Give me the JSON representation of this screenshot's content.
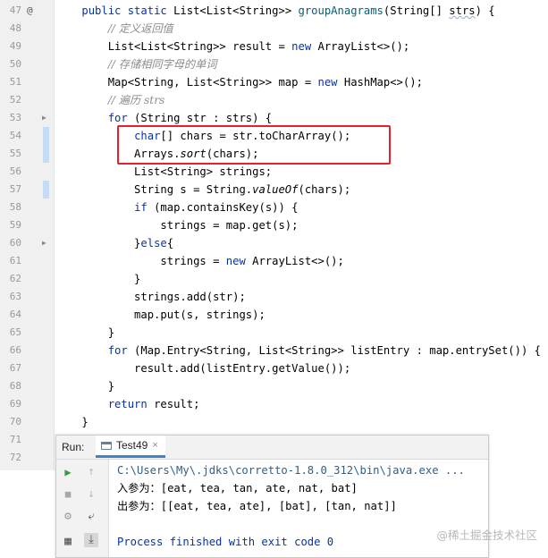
{
  "editor": {
    "lines": [
      {
        "num": "47",
        "html": "    <span class=\"kw\">public static</span> List&lt;List&lt;String&gt;&gt; <span class=\"fn\">groupAnagrams</span>(String[] <span class=\"wavy\">strs</span>) {"
      },
      {
        "num": "48",
        "html": "        <span class=\"cm\">// 定义返回值</span>"
      },
      {
        "num": "49",
        "html": "        List&lt;List&lt;String&gt;&gt; result = <span class=\"kw\">new</span> ArrayList&lt;&gt;();"
      },
      {
        "num": "50",
        "html": "        <span class=\"cm\">// 存储相同字母的单词</span>"
      },
      {
        "num": "51",
        "html": "        Map&lt;String, List&lt;String&gt;&gt; map = <span class=\"kw\">new</span> HashMap&lt;&gt;();"
      },
      {
        "num": "52",
        "html": "        <span class=\"cm\">// 遍历 strs</span>"
      },
      {
        "num": "53",
        "html": "        <span class=\"kw\">for</span> (String str : strs) {"
      },
      {
        "num": "54",
        "html": "            <span class=\"kw\">char</span>[] chars = str.toCharArray();"
      },
      {
        "num": "55",
        "html": "            Arrays.<span class=\"it\">sort</span>(chars);"
      },
      {
        "num": "56",
        "html": "            List&lt;String&gt; strings;"
      },
      {
        "num": "57",
        "html": "            String s = String.<span class=\"it\">valueOf</span>(chars);"
      },
      {
        "num": "58",
        "html": "            <span class=\"kw\">if</span> (map.containsKey(s)) {"
      },
      {
        "num": "59",
        "html": "                strings = map.get(s);"
      },
      {
        "num": "60",
        "html": "            }<span class=\"kw\">else</span>{"
      },
      {
        "num": "61",
        "html": "                strings = <span class=\"kw\">new</span> ArrayList&lt;&gt;();"
      },
      {
        "num": "62",
        "html": "            }"
      },
      {
        "num": "63",
        "html": "            strings.add(str);"
      },
      {
        "num": "64",
        "html": "            map.put(s, strings);"
      },
      {
        "num": "65",
        "html": "        }"
      },
      {
        "num": "66",
        "html": "        <span class=\"kw\">for</span> (Map.Entry&lt;String, List&lt;String&gt;&gt; listEntry : map.entrySet()) {"
      },
      {
        "num": "67",
        "html": "            result.add(listEntry.getValue());"
      },
      {
        "num": "68",
        "html": "        }"
      },
      {
        "num": "69",
        "html": "        <span class=\"kw\">return</span> result;"
      },
      {
        "num": "70",
        "html": "    }"
      },
      {
        "num": "71",
        "html": ""
      },
      {
        "num": "72",
        "html": ""
      }
    ],
    "override_marker": "@",
    "fold_marker": "▶"
  },
  "run_panel": {
    "label": "Run:",
    "tab_title": "Test49",
    "tab_close": "×",
    "console": {
      "command": "C:\\Users\\My\\.jdks\\corretto-1.8.0_312\\bin\\java.exe ...",
      "input_label": "入参为：",
      "input_value": "[eat, tea, tan, ate, nat, bat]",
      "output_label": "出参为：",
      "output_value": "[[eat, tea, ate], [bat], [tan, nat]]",
      "exit_message": "Process finished with exit code 0"
    }
  },
  "watermark": "@稀土掘金技术社区",
  "colors": {
    "keyword": "#0033b3",
    "method": "#00627a",
    "comment": "#8c8c8c",
    "highlight_box": "#e5212e",
    "run_icon": "#3c9a3c"
  }
}
